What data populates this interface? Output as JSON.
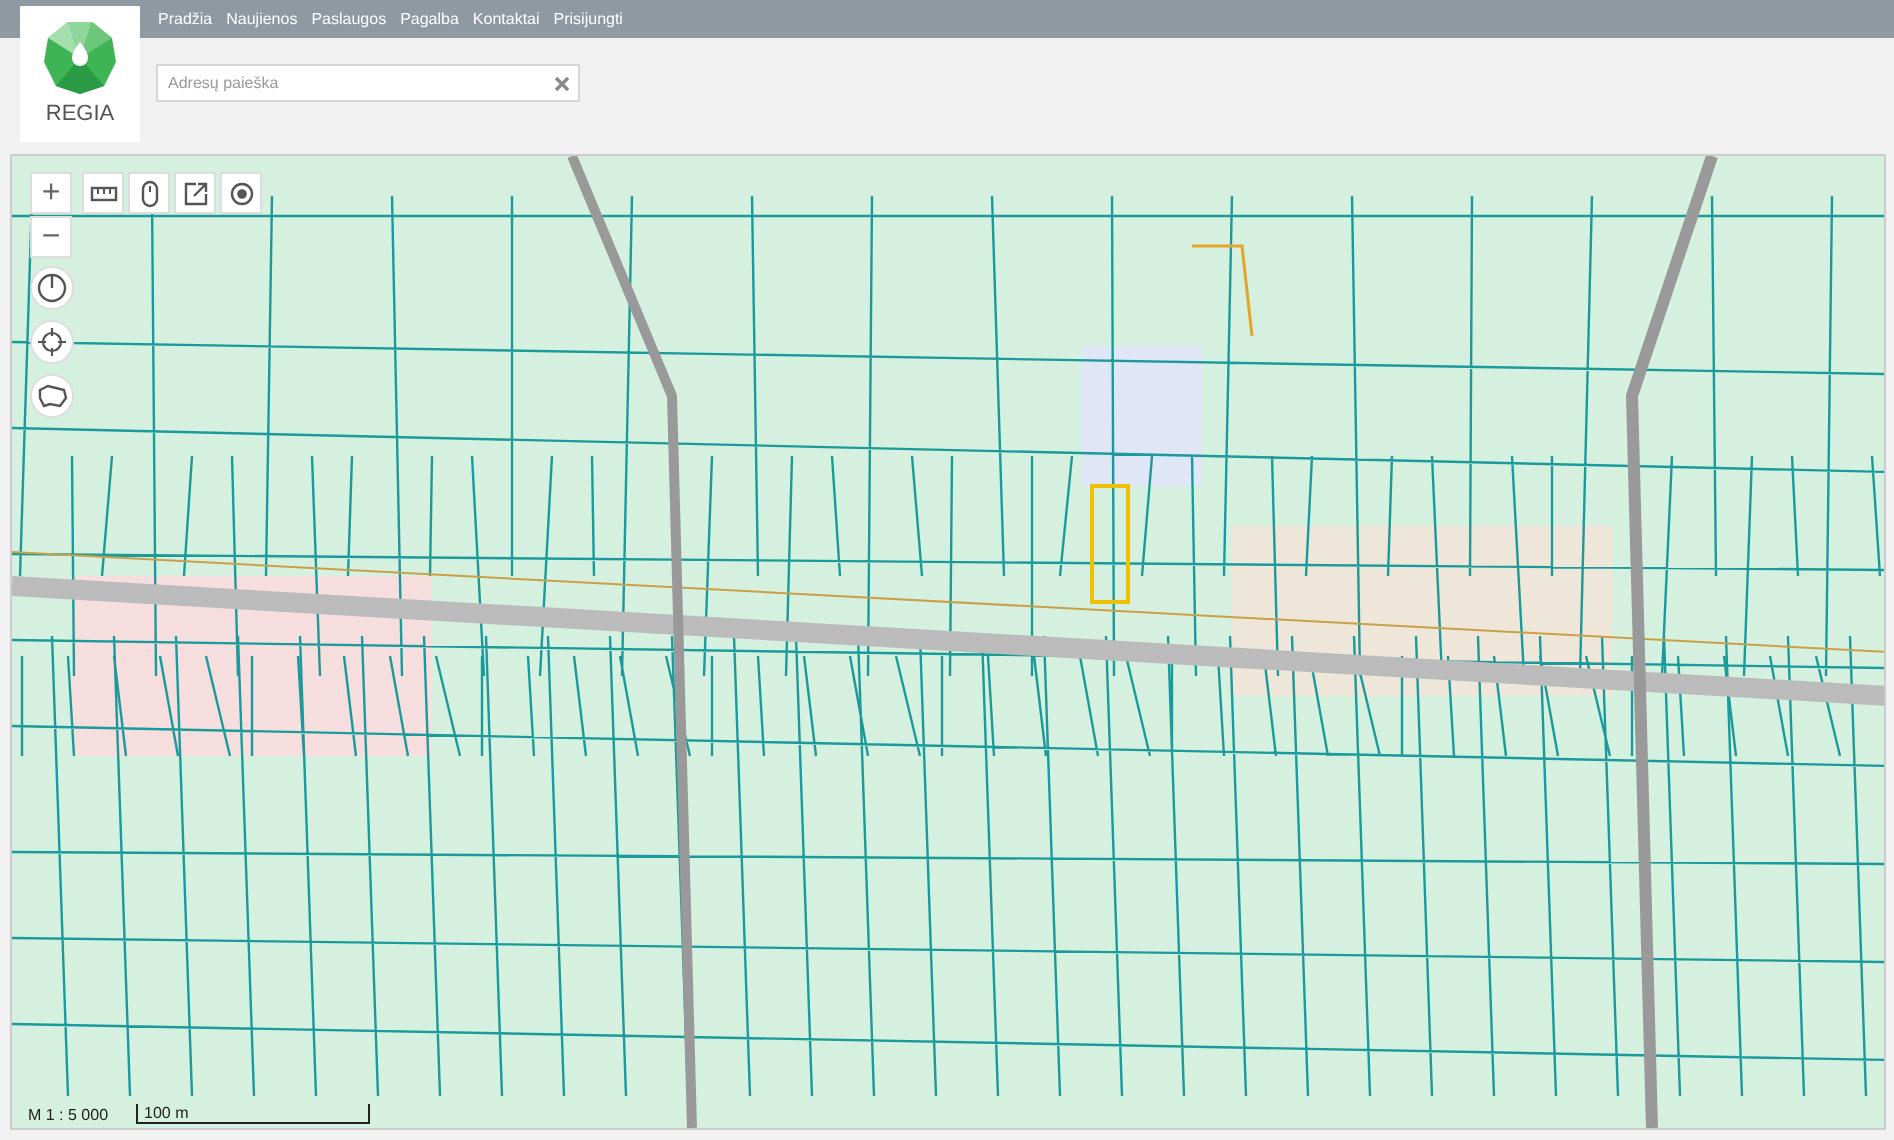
{
  "header": {
    "logo_text": "REGIA",
    "nav": [
      {
        "label": "Pradžia"
      },
      {
        "label": "Naujienos"
      },
      {
        "label": "Paslaugos"
      },
      {
        "label": "Pagalba"
      },
      {
        "label": "Kontaktai"
      },
      {
        "label": "Prisijungti"
      }
    ]
  },
  "search": {
    "placeholder": "Adresų paieška"
  },
  "map": {
    "zoom_in": "+",
    "zoom_out": "−",
    "tools": [
      {
        "kind": "ruler"
      },
      {
        "kind": "mouse"
      },
      {
        "kind": "share"
      },
      {
        "kind": "target"
      }
    ],
    "side_tools": [
      {
        "kind": "power"
      },
      {
        "kind": "locate"
      },
      {
        "kind": "region"
      }
    ],
    "scale_ratio": "M 1 : 5 000",
    "scale_bar": "100 m"
  }
}
